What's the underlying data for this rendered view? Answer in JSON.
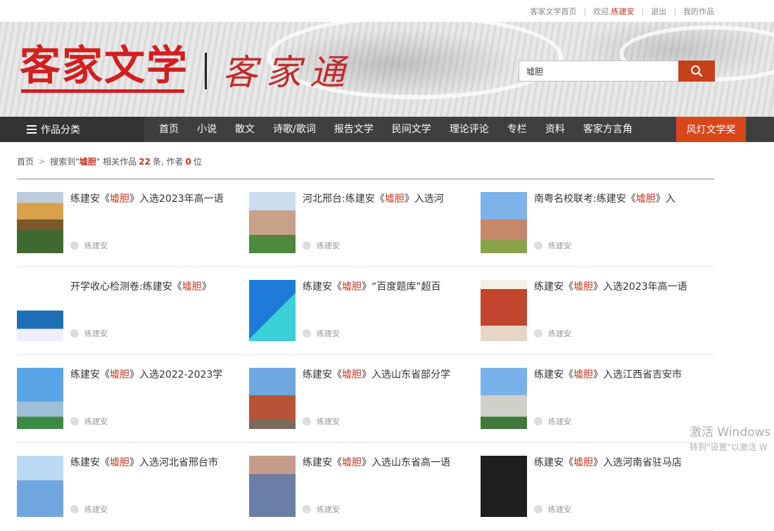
{
  "topbar": {
    "home": "客家文学首页",
    "welcome": "欢迎,",
    "user": "练建安",
    "logout": "退出",
    "my_works": "我的作品"
  },
  "logo": {
    "main": "客家文学",
    "sub": "客家通"
  },
  "search": {
    "value": "墟胆",
    "button_icon": "search-icon"
  },
  "nav": {
    "category": "作品分类",
    "items": [
      "首页",
      "小说",
      "散文",
      "诗歌/歌词",
      "报告文学",
      "民间文学",
      "理论评论",
      "专栏",
      "资料",
      "客家方言角"
    ],
    "award": "风灯文学奖"
  },
  "breadcrumb": {
    "home": "首页",
    "prefix": "搜索到\"",
    "keyword": "墟胆",
    "middle": "\" 相关作品",
    "works_count": "22",
    "unit1": "条, 作者",
    "authors_count": "0",
    "unit2": "位"
  },
  "results": [
    {
      "pre": "练建安《",
      "kw": "墟胆",
      "post": "》入选2023年高一语",
      "author": "练建安",
      "thumb": "autumn"
    },
    {
      "pre": "河北邢台:练建安《",
      "kw": "墟胆",
      "post": "》入选河",
      "author": "练建安",
      "thumb": "school"
    },
    {
      "pre": "南粤名校联考:练建安《",
      "kw": "墟胆",
      "post": "》入",
      "author": "练建安",
      "thumb": "gate"
    },
    {
      "pre": "开学收心检测卷:练建安《",
      "kw": "墟胆",
      "post": "》",
      "author": "练建安",
      "thumb": "doc"
    },
    {
      "pre": "练建安《",
      "kw": "墟胆",
      "post": "》“百度题库”超百",
      "author": "练建安",
      "thumb": "poster"
    },
    {
      "pre": "练建安《",
      "kw": "墟胆",
      "post": "》入选2023年高一语",
      "author": "练建安",
      "thumb": "books"
    },
    {
      "pre": "练建安《",
      "kw": "墟胆",
      "post": "》入选2022-2023学",
      "author": "练建安",
      "thumb": "city"
    },
    {
      "pre": "练建安《",
      "kw": "墟胆",
      "post": "》入选山东省部分学",
      "author": "练建安",
      "thumb": "building"
    },
    {
      "pre": "练建安《",
      "kw": "墟胆",
      "post": "》入选江西省吉安市",
      "author": "练建安",
      "thumb": "campus"
    },
    {
      "pre": "练建安《",
      "kw": "墟胆",
      "post": "》入选河北省邢台市",
      "author": "练建安",
      "thumb": "sky"
    },
    {
      "pre": "练建安《",
      "kw": "墟胆",
      "post": "》入选山东省高一语",
      "author": "练建安",
      "thumb": "dusk"
    },
    {
      "pre": "练建安《",
      "kw": "墟胆",
      "post": "》入选河南省驻马店",
      "author": "练建安",
      "thumb": "dark"
    }
  ],
  "watermark": {
    "line1": "激活 Windows",
    "line2": "转到\"设置\"以激活 W"
  },
  "colors": {
    "accent": "#c0341c",
    "nav_bg": "#3f3f3f",
    "award_bg": "#d8461a",
    "search_btn": "#c8401a"
  }
}
